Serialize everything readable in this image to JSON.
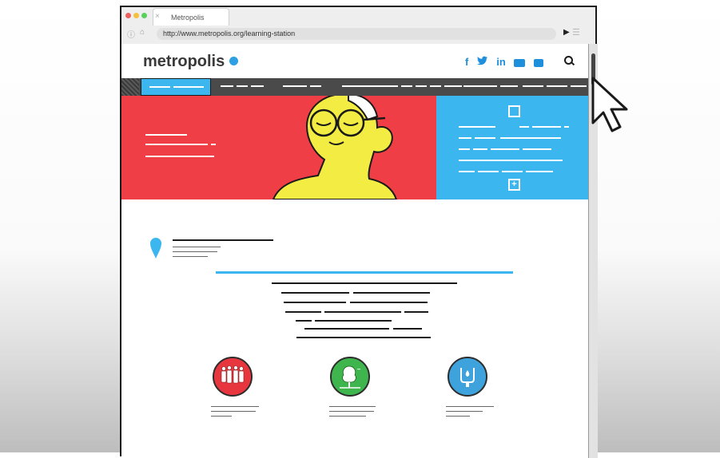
{
  "browser": {
    "tab_title": "Metropolis",
    "tab_close": "×",
    "url": "http://www.metropolis.org/learning-station",
    "dots": [
      "#ec5f5f",
      "#f4c041",
      "#5ad15a"
    ]
  },
  "site": {
    "logo_text": "metropolis",
    "accent_color": "#2e9fe3",
    "social_icons": [
      {
        "name": "facebook-icon",
        "glyph": "f"
      },
      {
        "name": "twitter-icon",
        "glyph": "🐦"
      },
      {
        "name": "linkedin-icon",
        "glyph": "in"
      },
      {
        "name": "youtube-icon",
        "glyph": "▶"
      },
      {
        "name": "flickr-icon",
        "glyph": "●●"
      }
    ],
    "search_icon": "search-icon"
  },
  "colors": {
    "hero_red": "#ef3e45",
    "hero_blue": "#3cb6ef",
    "nav_dark": "#4a4a4a",
    "feature_red": "#e8363f",
    "feature_green": "#3fb54d",
    "feature_blue": "#3ea3dc"
  },
  "icons": [
    "location-pin-icon",
    "people-group-icon",
    "tree-icon",
    "water-tap-icon",
    "checkbox-icon",
    "plus-icon",
    "mouse-cursor-icon",
    "home-icon",
    "info-icon"
  ]
}
